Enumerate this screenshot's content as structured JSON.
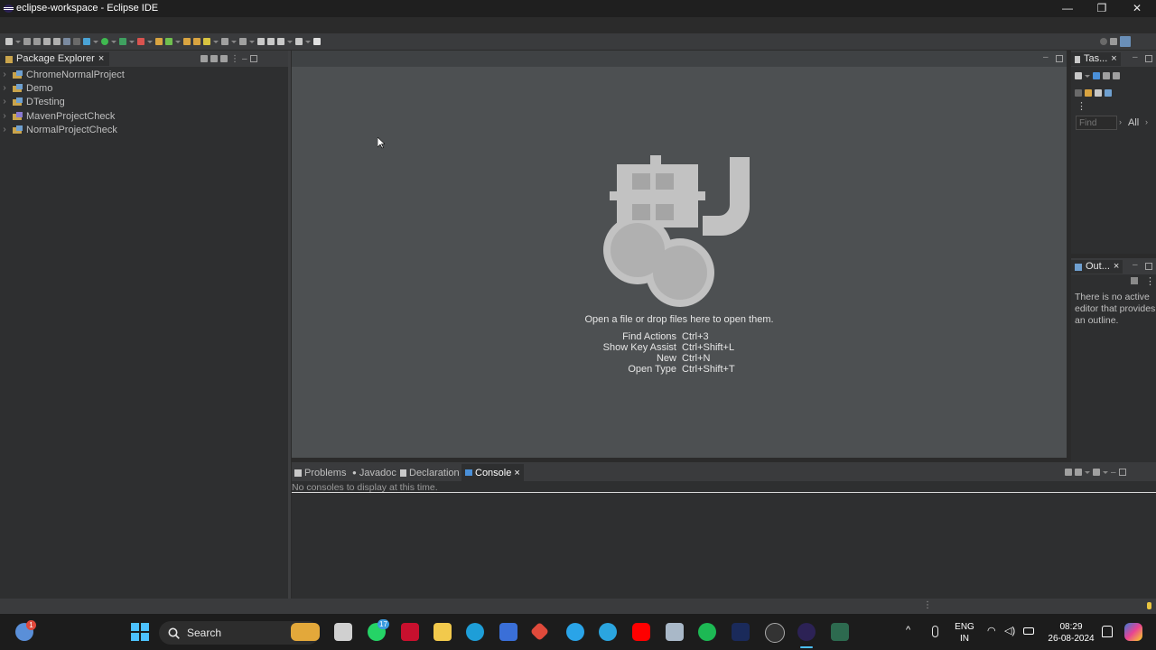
{
  "window": {
    "title": "eclipse-workspace - Eclipse IDE",
    "controls": {
      "minimize": "—",
      "maximize": "❐",
      "close": "✕"
    }
  },
  "package_explorer": {
    "tab_label": "Package Explorer",
    "close_glyph": "×",
    "projects": [
      {
        "name": "ChromeNormalProject"
      },
      {
        "name": "Demo"
      },
      {
        "name": "DTesting"
      },
      {
        "name": "MavenProjectCheck"
      },
      {
        "name": "NormalProjectCheck"
      }
    ]
  },
  "editor": {
    "hint": "Open a file or drop files here to open them.",
    "shortcuts": [
      {
        "action": "Find Actions",
        "keys": "Ctrl+3"
      },
      {
        "action": "Show Key Assist",
        "keys": "Ctrl+Shift+L"
      },
      {
        "action": "New",
        "keys": "Ctrl+N"
      },
      {
        "action": "Open Type",
        "keys": "Ctrl+Shift+T"
      }
    ]
  },
  "task_panel": {
    "tab_label": "Tas...",
    "find_placeholder": "Find",
    "all_label": "All"
  },
  "outline_panel": {
    "tab_label": "Out...",
    "message": "There is no active editor that provides an outline."
  },
  "bottom_panel": {
    "tabs": [
      {
        "label": "Problems"
      },
      {
        "label": "Javadoc"
      },
      {
        "label": "Declaration"
      },
      {
        "label": "Console"
      }
    ],
    "console_message": "No consoles to display at this time."
  },
  "taskbar": {
    "search_label": "Search",
    "lang_line1": "ENG",
    "lang_line2": "IN",
    "time": "08:29",
    "date": "26-08-2024",
    "whatsapp_badge": "17",
    "weather_badge": "1"
  },
  "colors": {
    "accent": "#4a90d9",
    "editor_bg": "#4d5052",
    "logo_gray": "#c2c2c2"
  }
}
